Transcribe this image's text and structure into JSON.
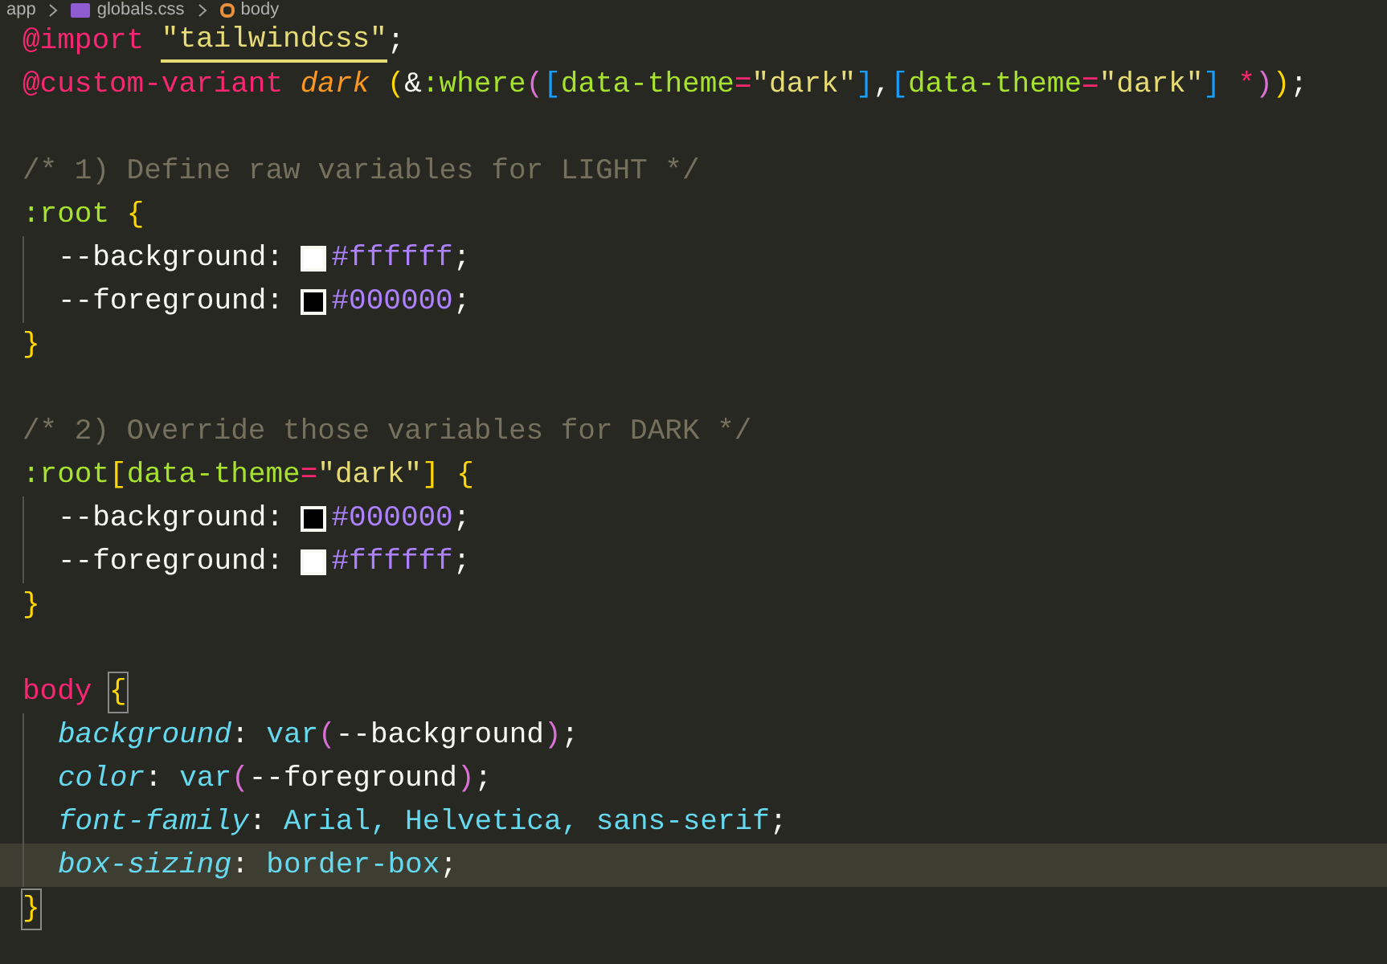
{
  "breadcrumb": [
    {
      "label": "app",
      "kind": "folder"
    },
    {
      "label": "globals.css",
      "kind": "css"
    },
    {
      "label": "body",
      "kind": "symbol"
    }
  ],
  "lines": [
    {
      "kind": "code",
      "guide": false,
      "current": false,
      "tokens": [
        {
          "kind": "at",
          "text": "@import "
        },
        {
          "kind": "string",
          "text": "\"tailwindcss\"",
          "underline": true
        },
        {
          "kind": "plain",
          "text": ";"
        }
      ]
    },
    {
      "kind": "code",
      "guide": false,
      "current": false,
      "tokens": [
        {
          "kind": "at",
          "text": "@custom-variant "
        },
        {
          "kind": "variant",
          "text": "dark "
        },
        {
          "kind": "gold",
          "text": "("
        },
        {
          "kind": "plain",
          "text": "&"
        },
        {
          "kind": "selector",
          "text": ":where"
        },
        {
          "kind": "magenta",
          "text": "("
        },
        {
          "kind": "blue",
          "text": "["
        },
        {
          "kind": "selector",
          "text": "data-theme"
        },
        {
          "kind": "op",
          "text": "="
        },
        {
          "kind": "string",
          "text": "\"dark\""
        },
        {
          "kind": "blue",
          "text": "]"
        },
        {
          "kind": "plain",
          "text": ","
        },
        {
          "kind": "blue",
          "text": "["
        },
        {
          "kind": "selector",
          "text": "data-theme"
        },
        {
          "kind": "op",
          "text": "="
        },
        {
          "kind": "string",
          "text": "\"dark\""
        },
        {
          "kind": "blue",
          "text": "]"
        },
        {
          "kind": "op",
          "text": " *"
        },
        {
          "kind": "magenta",
          "text": ")"
        },
        {
          "kind": "gold",
          "text": ")"
        },
        {
          "kind": "plain",
          "text": ";"
        }
      ]
    },
    {
      "kind": "blank"
    },
    {
      "kind": "code",
      "guide": false,
      "current": false,
      "tokens": [
        {
          "kind": "comment",
          "text": "/* 1) Define raw variables for LIGHT */"
        }
      ]
    },
    {
      "kind": "code",
      "guide": false,
      "current": false,
      "tokens": [
        {
          "kind": "selector",
          "text": ":root "
        },
        {
          "kind": "gold",
          "text": "{"
        }
      ]
    },
    {
      "kind": "code",
      "guide": true,
      "current": false,
      "tokens": [
        {
          "kind": "plain",
          "text": "--background: "
        },
        {
          "kind": "swatch",
          "color": "#ffffff"
        },
        {
          "kind": "number",
          "text": "#ffffff"
        },
        {
          "kind": "plain",
          "text": ";"
        }
      ]
    },
    {
      "kind": "code",
      "guide": true,
      "current": false,
      "tokens": [
        {
          "kind": "plain",
          "text": "--foreground: "
        },
        {
          "kind": "swatch",
          "color": "#000000"
        },
        {
          "kind": "number",
          "text": "#000000"
        },
        {
          "kind": "plain",
          "text": ";"
        }
      ]
    },
    {
      "kind": "code",
      "guide": false,
      "current": false,
      "tokens": [
        {
          "kind": "gold",
          "text": "}"
        }
      ]
    },
    {
      "kind": "blank"
    },
    {
      "kind": "code",
      "guide": false,
      "current": false,
      "tokens": [
        {
          "kind": "comment",
          "text": "/* 2) Override those variables for DARK */"
        }
      ]
    },
    {
      "kind": "code",
      "guide": false,
      "current": false,
      "tokens": [
        {
          "kind": "selector",
          "text": ":root"
        },
        {
          "kind": "gold",
          "text": "["
        },
        {
          "kind": "selector",
          "text": "data-theme"
        },
        {
          "kind": "op",
          "text": "="
        },
        {
          "kind": "string",
          "text": "\"dark\""
        },
        {
          "kind": "gold",
          "text": "] {"
        }
      ]
    },
    {
      "kind": "code",
      "guide": true,
      "current": false,
      "tokens": [
        {
          "kind": "plain",
          "text": "--background: "
        },
        {
          "kind": "swatch",
          "color": "#000000"
        },
        {
          "kind": "number",
          "text": "#000000"
        },
        {
          "kind": "plain",
          "text": ";"
        }
      ]
    },
    {
      "kind": "code",
      "guide": true,
      "current": false,
      "tokens": [
        {
          "kind": "plain",
          "text": "--foreground: "
        },
        {
          "kind": "swatch",
          "color": "#ffffff"
        },
        {
          "kind": "number",
          "text": "#ffffff"
        },
        {
          "kind": "plain",
          "text": ";"
        }
      ]
    },
    {
      "kind": "code",
      "guide": false,
      "current": false,
      "tokens": [
        {
          "kind": "gold",
          "text": "}"
        }
      ]
    },
    {
      "kind": "blank"
    },
    {
      "kind": "code",
      "guide": false,
      "current": false,
      "tokens": [
        {
          "kind": "at",
          "text": "body "
        },
        {
          "kind": "gold",
          "text": "{",
          "matched": true
        }
      ]
    },
    {
      "kind": "code",
      "guide": true,
      "current": false,
      "tokens": [
        {
          "kind": "prop",
          "text": "background"
        },
        {
          "kind": "plain",
          "text": ": "
        },
        {
          "kind": "value",
          "text": "var"
        },
        {
          "kind": "magenta",
          "text": "("
        },
        {
          "kind": "plain",
          "text": "--background"
        },
        {
          "kind": "magenta",
          "text": ")"
        },
        {
          "kind": "plain",
          "text": ";"
        }
      ]
    },
    {
      "kind": "code",
      "guide": true,
      "current": false,
      "tokens": [
        {
          "kind": "prop",
          "text": "color"
        },
        {
          "kind": "plain",
          "text": ": "
        },
        {
          "kind": "value",
          "text": "var"
        },
        {
          "kind": "magenta",
          "text": "("
        },
        {
          "kind": "plain",
          "text": "--foreground"
        },
        {
          "kind": "magenta",
          "text": ")"
        },
        {
          "kind": "plain",
          "text": ";"
        }
      ]
    },
    {
      "kind": "code",
      "guide": true,
      "current": false,
      "tokens": [
        {
          "kind": "prop",
          "text": "font-family"
        },
        {
          "kind": "plain",
          "text": ": "
        },
        {
          "kind": "value",
          "text": "Arial, Helvetica, sans-serif"
        },
        {
          "kind": "plain",
          "text": ";"
        }
      ]
    },
    {
      "kind": "code",
      "guide": true,
      "current": true,
      "tokens": [
        {
          "kind": "prop",
          "text": "box-sizing"
        },
        {
          "kind": "plain",
          "text": ": "
        },
        {
          "kind": "value",
          "text": "border-box"
        },
        {
          "kind": "plain",
          "text": ";"
        }
      ]
    },
    {
      "kind": "code",
      "guide": false,
      "current": false,
      "tokens": [
        {
          "kind": "gold",
          "text": "}",
          "matched": true
        }
      ]
    }
  ]
}
